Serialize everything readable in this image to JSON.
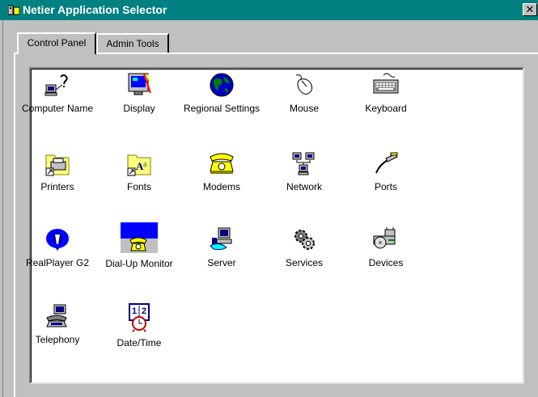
{
  "window": {
    "title": "Netier Application Selector",
    "close_glyph": "✕",
    "title_bar_color": "#008080"
  },
  "tabs": [
    {
      "label": "Control Panel",
      "active": true
    },
    {
      "label": "Admin Tools",
      "active": false
    }
  ],
  "icons": [
    {
      "label": "Computer Name",
      "icon": "computer-name-icon"
    },
    {
      "label": "Display",
      "icon": "display-icon"
    },
    {
      "label": "Regional Settings",
      "icon": "globe-icon"
    },
    {
      "label": "Mouse",
      "icon": "mouse-icon"
    },
    {
      "label": "Keyboard",
      "icon": "keyboard-icon"
    },
    {
      "label": "Printers",
      "icon": "printer-folder-icon"
    },
    {
      "label": "Fonts",
      "icon": "fonts-folder-icon"
    },
    {
      "label": "Modems",
      "icon": "telephone-icon"
    },
    {
      "label": "Network",
      "icon": "network-icon"
    },
    {
      "label": "Ports",
      "icon": "port-cable-icon"
    },
    {
      "label": "RealPlayer G2",
      "icon": "realplayer-icon"
    },
    {
      "label": "Dial-Up Monitor",
      "icon": "dialup-monitor-icon"
    },
    {
      "label": "Server",
      "icon": "server-icon"
    },
    {
      "label": "Services",
      "icon": "gears-icon"
    },
    {
      "label": "Devices",
      "icon": "devices-icon"
    },
    {
      "label": "Telephony",
      "icon": "telephony-icon"
    },
    {
      "label": "Date/Time",
      "icon": "calendar-clock-icon"
    }
  ]
}
